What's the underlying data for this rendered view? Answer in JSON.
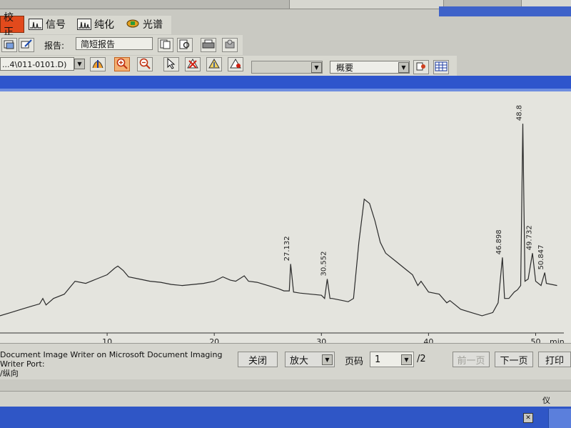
{
  "tabs": [
    {
      "label": "校正"
    },
    {
      "label": "信号"
    },
    {
      "label": "纯化"
    },
    {
      "label": "光谱"
    }
  ],
  "report": {
    "label": "报告:",
    "value": "简短报告"
  },
  "file_row": {
    "file": "...4\\011-0101.D)",
    "summary": "概要"
  },
  "chart_data": {
    "type": "line",
    "title": "",
    "xlabel": "",
    "ylabel": "",
    "x_unit_label": "min",
    "xlim": [
      0,
      52.5
    ],
    "ylim": [
      0,
      100
    ],
    "x_ticks": [
      10,
      20,
      30,
      40,
      50
    ],
    "tick_labels": [
      "10",
      "20",
      "30",
      "40",
      "50"
    ],
    "series": [
      {
        "points": [
          [
            0,
            6
          ],
          [
            1,
            7.5
          ],
          [
            2,
            9
          ],
          [
            3,
            10.5
          ],
          [
            3.7,
            11.5
          ],
          [
            4,
            14
          ],
          [
            4.3,
            11
          ],
          [
            5,
            14
          ],
          [
            6,
            16
          ],
          [
            6.5,
            19
          ],
          [
            7,
            22
          ],
          [
            8,
            21
          ],
          [
            9,
            23
          ],
          [
            10,
            25
          ],
          [
            10.7,
            28
          ],
          [
            11,
            29
          ],
          [
            11.5,
            27
          ],
          [
            12,
            24
          ],
          [
            13,
            23
          ],
          [
            14,
            22
          ],
          [
            15,
            21.5
          ],
          [
            16,
            20.5
          ],
          [
            17,
            20
          ],
          [
            18,
            20.5
          ],
          [
            19,
            21
          ],
          [
            20,
            22
          ],
          [
            20.8,
            24
          ],
          [
            21.5,
            22.5
          ],
          [
            22,
            22
          ],
          [
            22.8,
            24.5
          ],
          [
            23.2,
            22
          ],
          [
            24,
            21.5
          ],
          [
            25,
            20
          ],
          [
            26,
            18.5
          ],
          [
            26.5,
            17.5
          ],
          [
            27,
            17.5
          ],
          [
            27.13,
            30
          ],
          [
            27.4,
            17
          ],
          [
            28,
            16.5
          ],
          [
            29,
            16
          ],
          [
            30,
            15.5
          ],
          [
            30.3,
            14
          ],
          [
            30.55,
            23
          ],
          [
            30.8,
            14
          ],
          [
            31,
            14
          ],
          [
            32,
            13
          ],
          [
            32.5,
            12.5
          ],
          [
            33,
            14
          ],
          [
            33.5,
            40
          ],
          [
            34,
            60
          ],
          [
            34.5,
            58
          ],
          [
            35,
            50
          ],
          [
            35.5,
            40
          ],
          [
            36,
            35
          ],
          [
            37,
            31
          ],
          [
            38,
            27
          ],
          [
            38.5,
            25
          ],
          [
            39,
            20
          ],
          [
            39.3,
            22
          ],
          [
            40,
            17
          ],
          [
            41,
            16
          ],
          [
            41.7,
            12
          ],
          [
            42,
            13
          ],
          [
            43,
            9
          ],
          [
            44,
            7.5
          ],
          [
            45,
            6
          ],
          [
            46,
            7.5
          ],
          [
            46.5,
            12
          ],
          [
            46.9,
            33
          ],
          [
            47.1,
            14
          ],
          [
            47.5,
            14
          ],
          [
            48,
            17
          ],
          [
            48.3,
            18
          ],
          [
            48.6,
            20
          ],
          [
            48.8,
            95
          ],
          [
            49,
            22
          ],
          [
            49.3,
            23
          ],
          [
            49.7,
            35
          ],
          [
            50,
            22
          ],
          [
            50.5,
            20
          ],
          [
            50.85,
            26
          ],
          [
            51,
            21
          ],
          [
            52,
            20
          ]
        ]
      }
    ],
    "peaks": [
      {
        "label": "27.132",
        "x": 27.132,
        "y": 30
      },
      {
        "label": "30.552",
        "x": 30.552,
        "y": 23
      },
      {
        "label": "46.898",
        "x": 46.898,
        "y": 33
      },
      {
        "label": "48.8",
        "x": 48.8,
        "y": 95
      },
      {
        "label": "49.732",
        "x": 49.732,
        "y": 35
      },
      {
        "label": "50.847",
        "x": 50.847,
        "y": 26
      }
    ],
    "line_color": "#2a2a2a"
  },
  "printer": {
    "line1": "Document Image Writer on Microsoft Document Imaging Writer Port:",
    "line2": "/纵向"
  },
  "controls": {
    "close": "关闭",
    "zoom": "放大",
    "page_label": "页码",
    "page": "1",
    "page_total": "/2",
    "prev": "前一页",
    "next": "下一页",
    "print": "打印"
  },
  "status": {
    "text": "仪"
  }
}
